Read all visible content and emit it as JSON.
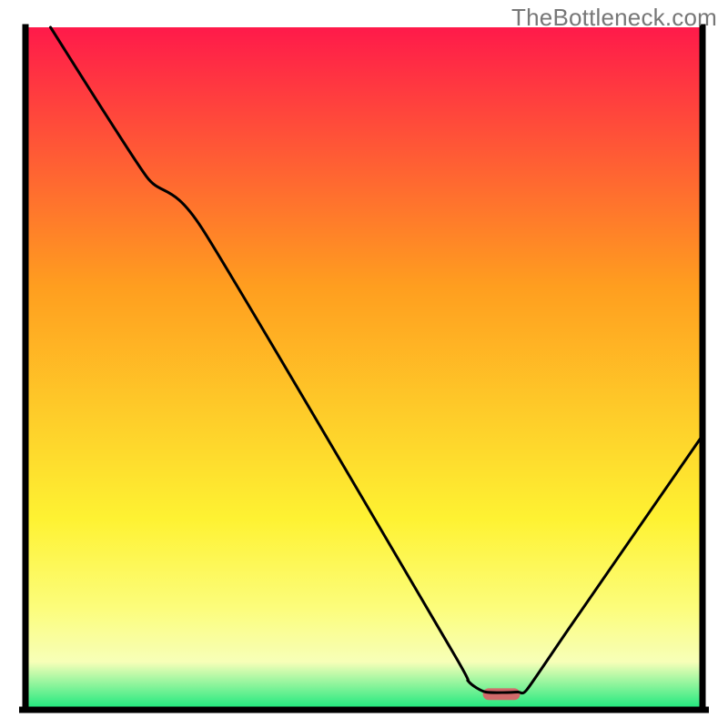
{
  "watermark": "TheBottleneck.com",
  "colors": {
    "red": "#ff1a4a",
    "orange": "#ff9e1f",
    "yellow": "#fef232",
    "yellow2": "#fcfd7b",
    "pale": "#f7ffb8",
    "green": "#17e87c",
    "stroke": "#000000",
    "frame": "#000000",
    "marker": "#d16a6a"
  },
  "chart_data": {
    "type": "line",
    "title": "",
    "xlabel": "",
    "ylabel": "",
    "xlim": [
      0,
      100
    ],
    "ylim": [
      0,
      100
    ],
    "note": "No axis ticks or numeric labels are visible; values are percentage positions within the plot area, estimated from geometry.",
    "series": [
      {
        "name": "curve",
        "points": [
          {
            "x": 3.7,
            "y": 100.0
          },
          {
            "x": 17.9,
            "y": 78.1
          },
          {
            "x": 26.1,
            "y": 70.5
          },
          {
            "x": 62.8,
            "y": 9.0
          },
          {
            "x": 65.4,
            "y": 4.2
          },
          {
            "x": 68.0,
            "y": 2.6
          },
          {
            "x": 72.7,
            "y": 2.6
          },
          {
            "x": 74.1,
            "y": 3.0
          },
          {
            "x": 80.6,
            "y": 12.4
          },
          {
            "x": 100.0,
            "y": 40.2
          }
        ]
      }
    ],
    "marker": {
      "x_center": 70.3,
      "y": 2.3,
      "width": 5.5,
      "height": 1.7
    },
    "background_gradient_stops_pct": [
      {
        "offset": 0,
        "color_key": "red"
      },
      {
        "offset": 38,
        "color_key": "orange"
      },
      {
        "offset": 72,
        "color_key": "yellow"
      },
      {
        "offset": 85,
        "color_key": "yellow2"
      },
      {
        "offset": 93,
        "color_key": "pale"
      },
      {
        "offset": 100,
        "color_key": "green"
      }
    ]
  }
}
